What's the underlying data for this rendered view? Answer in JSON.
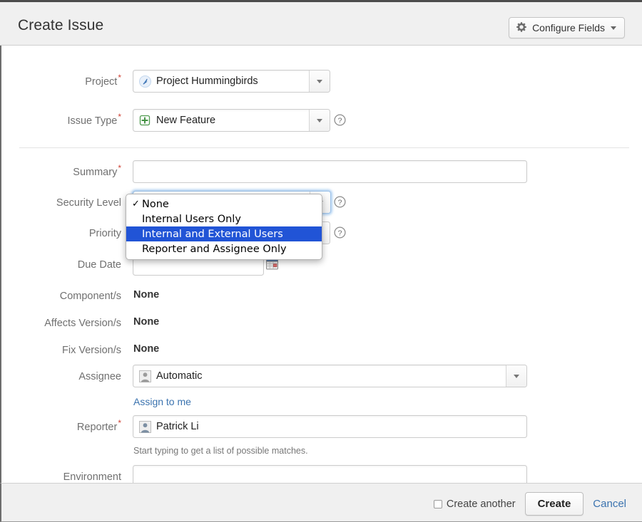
{
  "header": {
    "title": "Create Issue",
    "configure_fields_label": "Configure Fields",
    "gear_icon": "gear-icon",
    "caret_icon": "chevron-down-icon"
  },
  "form": {
    "project": {
      "label": "Project",
      "required": true,
      "value": "Project Hummingbirds",
      "icon": "project-avatar-icon"
    },
    "issue_type": {
      "label": "Issue Type",
      "required": true,
      "value": "New Feature",
      "icon": "new-feature-icon",
      "help_icon": "help-icon"
    },
    "summary": {
      "label": "Summary",
      "required": true,
      "value": "",
      "placeholder": ""
    },
    "security_level": {
      "label": "Security Level",
      "required": false,
      "value": "None",
      "help_icon": "help-icon",
      "options": [
        "None",
        "Internal Users Only",
        "Internal and External Users",
        "Reporter and Assignee Only"
      ],
      "checked_index": 0,
      "highlighted_index": 2,
      "check_glyph": "✓"
    },
    "priority": {
      "label": "Priority",
      "required": false,
      "value": "",
      "help_icon": "help-icon"
    },
    "due_date": {
      "label": "Due Date",
      "required": false,
      "value": "",
      "calendar_icon": "calendar-icon"
    },
    "components": {
      "label": "Component/s",
      "value": "None"
    },
    "affects_versions": {
      "label": "Affects Version/s",
      "value": "None"
    },
    "fix_versions": {
      "label": "Fix Version/s",
      "value": "None"
    },
    "assignee": {
      "label": "Assignee",
      "required": false,
      "value": "Automatic",
      "icon": "user-avatar-icon",
      "assign_to_me_label": "Assign to me"
    },
    "reporter": {
      "label": "Reporter",
      "required": true,
      "value": "Patrick Li",
      "icon": "user-avatar-icon",
      "hint": "Start typing to get a list of possible matches."
    },
    "environment": {
      "label": "Environment",
      "value": ""
    }
  },
  "footer": {
    "create_another_label": "Create another",
    "create_another_checked": false,
    "create_label": "Create",
    "cancel_label": "Cancel"
  },
  "colors": {
    "header_bg": "#f0f0f0",
    "required_star": "#d04437",
    "link": "#3b73af",
    "highlight": "#2154d6",
    "focus_ring": "#6eaae6"
  }
}
